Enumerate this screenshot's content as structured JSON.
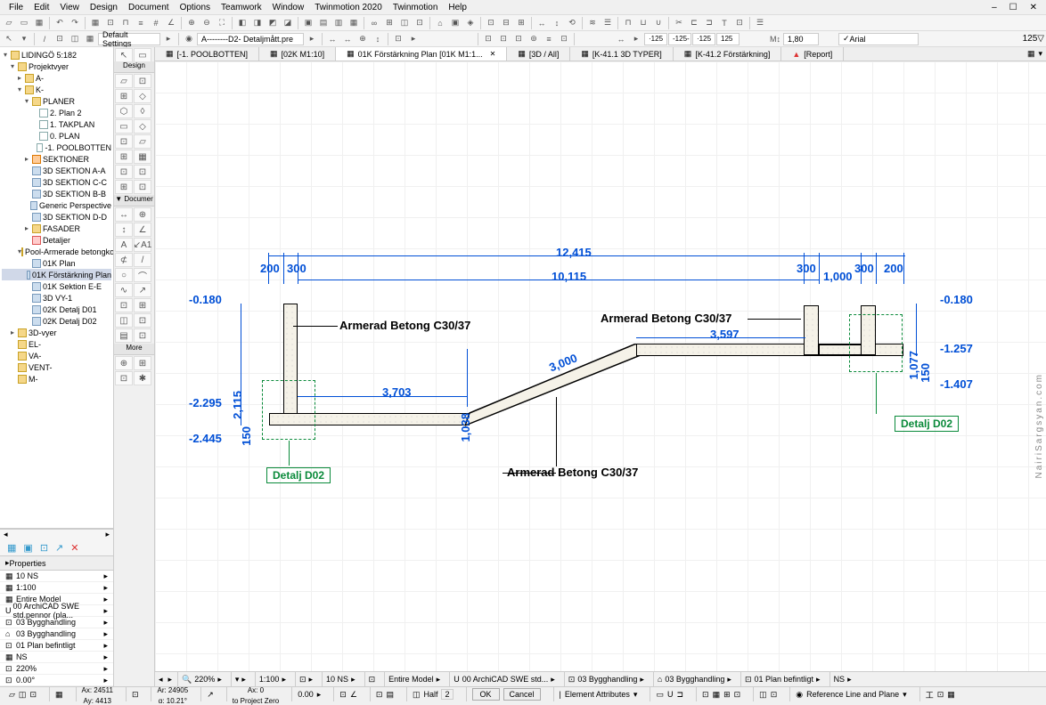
{
  "menu": {
    "items": [
      "File",
      "Edit",
      "View",
      "Design",
      "Document",
      "Options",
      "Teamwork",
      "Window",
      "Twinmotion 2020",
      "Twinmotion",
      "Help"
    ]
  },
  "window_controls": [
    "–",
    "☐",
    "✕"
  ],
  "infobar": {
    "default_settings": "Default Settings",
    "layer_combo": "A--------D2- Detaljmått.pre",
    "scale_input": "1,80",
    "font": "Arial",
    "angle": "125"
  },
  "tree": {
    "root": "LIDINGÖ 5:182",
    "l1a": "Projektvyer",
    "l2a": "A-",
    "l2b": "K-",
    "l3a": "PLANER",
    "l4_1": "2. Plan 2",
    "l4_2": "1. TAKPLAN",
    "l4_3": "0. PLAN",
    "l4_4": "-1. POOLBOTTEN",
    "l3b": "SEKTIONER",
    "sek1": "3D SEKTION A-A",
    "sek2": "3D SEKTION C-C",
    "sek3": "3D SEKTION B-B",
    "sek4": "Generic Perspective",
    "sek5": "3D SEKTION D-D",
    "l3c": "FASADER",
    "l3d": "Detaljer",
    "l3e": "Pool-Armerade betongkons",
    "p1": "01K Plan",
    "p2": "01K Förstärkning Plan",
    "p3": "01K Sektion E-E",
    "p4": "3D VY-1",
    "p5": "02K Detalj D01",
    "p6": "02K Detalj D02",
    "g1": "3D-vyer",
    "g2": "EL-",
    "g3": "VA-",
    "g4": "VENT-",
    "g5": "M-"
  },
  "props": {
    "header": "Properties",
    "r1": "10 NS",
    "r2": "1:100",
    "r3": "Entire Model",
    "r4": "00 ArchiCAD SWE std.pennor (pla...",
    "r5": "03 Bygghandling",
    "r6": "03 Bygghandling",
    "r7": "01 Plan befintligt",
    "r8": "NS",
    "r9": "220%",
    "r10": "0.00°"
  },
  "toolbox": {
    "design": "Design",
    "doc": "Documer",
    "more": "More"
  },
  "tabs": {
    "t1": "[-1. POOLBOTTEN]",
    "t2": "[02K M1:10]",
    "t3": "01K Förstärkning Plan [01K M1:1...",
    "t4": "[3D / All]",
    "t5": "[K-41.1 3D TYPER]",
    "t6": "[K-41.2 Förstärkning]",
    "t7": "[Report]"
  },
  "drawing": {
    "dim_top1": "12,415",
    "dim_top2": "10,115",
    "d200_l": "200",
    "d300_l": "300",
    "d300_r1": "300",
    "d300_r2": "300",
    "d200_r": "200",
    "d1000": "1,000",
    "d3703": "3,703",
    "d1038": "1,038",
    "d3000": "3,000",
    "d3597": "3,597",
    "d2115": "2,115",
    "d1077": "1,077",
    "d150_l": "150",
    "d150_r": "150",
    "lvl_m0180_l": "-0.180",
    "lvl_m0180_r": "-0.180",
    "lvl_m1257": "-1.257",
    "lvl_m1407": "-1.407",
    "lvl_m2295": "-2.295",
    "lvl_m2445": "-2.445",
    "concrete_label": "Armerad Betong C30/37",
    "detail_d02": "Detalj D02"
  },
  "hstatus": {
    "zoom": "220%",
    "scale": "1:100",
    "ns": "10 NS",
    "model": "Entire Model",
    "penset": "00 ArchiCAD SWE std...",
    "mvo1": "03 Bygghandling",
    "mvo2": "03 Bygghandling",
    "mvo3": "01 Plan befintligt",
    "mvo4": "NS"
  },
  "status": {
    "ax_left": "Ax: 24511",
    "ay_left": "Ay: 4413",
    "ax_mid": "Ar: 24905",
    "ay_mid": "α: 10.21°",
    "ax_r": "Ax: 0",
    "ay_r": "to Project Zero",
    "zoom_r": "0.00",
    "halfn": "Half",
    "half_num": "2",
    "ok": "OK",
    "cancel": "Cancel",
    "elem_attr": "Element Attributes",
    "refline": "Reference Line and Plane"
  },
  "watermark": "NairiSargsyan.com"
}
